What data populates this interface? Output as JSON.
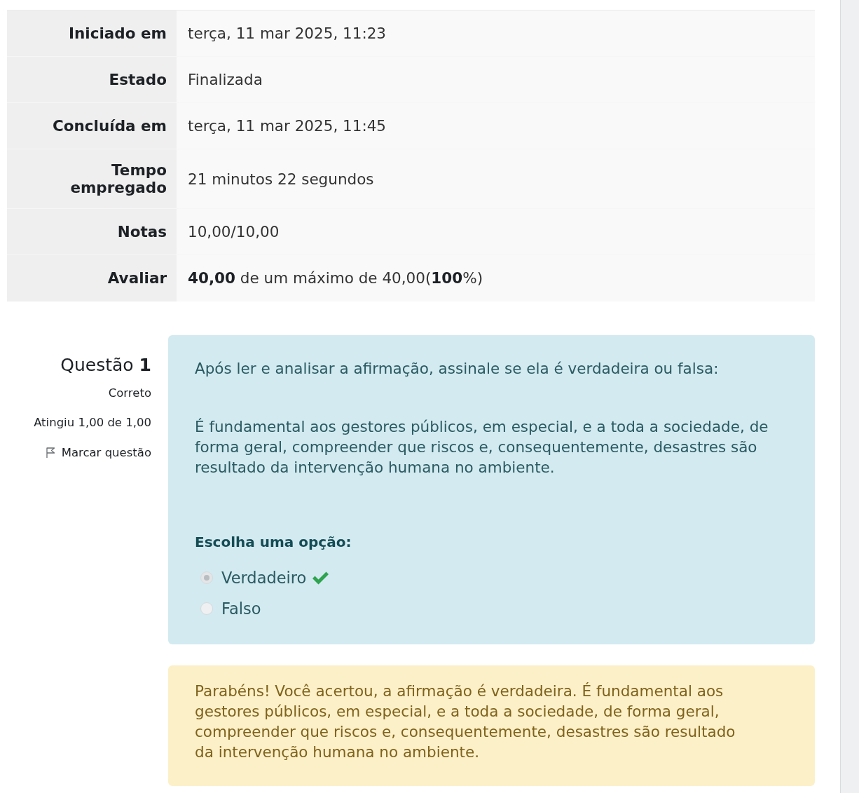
{
  "summary": [
    {
      "label": "Iniciado em",
      "value": "terça, 11 mar 2025, 11:23"
    },
    {
      "label": "Estado",
      "value": "Finalizada"
    },
    {
      "label": "Concluída em",
      "value": "terça, 11 mar 2025, 11:45"
    },
    {
      "label": "Tempo empregado",
      "value": "21 minutos 22 segundos"
    },
    {
      "label": "Notas",
      "value": "10,00/10,00"
    },
    {
      "label": "Avaliar",
      "value": "**40,00** de um máximo de 40,00(**100**%)"
    }
  ],
  "question": {
    "title": "Questão **1**",
    "status": "Correto",
    "mark": "Atingiu 1,00 de 1,00",
    "flag_link": "Marcar questão",
    "prompt": "Após ler e analisar a afirmação, assinale se ela é verdadeira ou falsa:",
    "statement": "É fundamental aos gestores públicos, em especial, e a toda a sociedade, de forma geral, compreender que riscos e, consequentemente, desastres são resultado da intervenção humana no ambiente.",
    "answer_prompt": "Escolha uma opção:",
    "options": [
      {
        "label": "Verdadeiro",
        "selected": true,
        "correct": true
      },
      {
        "label": "Falso",
        "selected": false,
        "correct": false
      }
    ],
    "feedback": "Parabéns! Você acertou, a afirmação é verdadeira. É fundamental aos gestores públicos, em especial, e a toda a sociedade, de forma geral, compreender que riscos e, consequentemente, desastres são resultado da intervenção humana no ambiente."
  }
}
